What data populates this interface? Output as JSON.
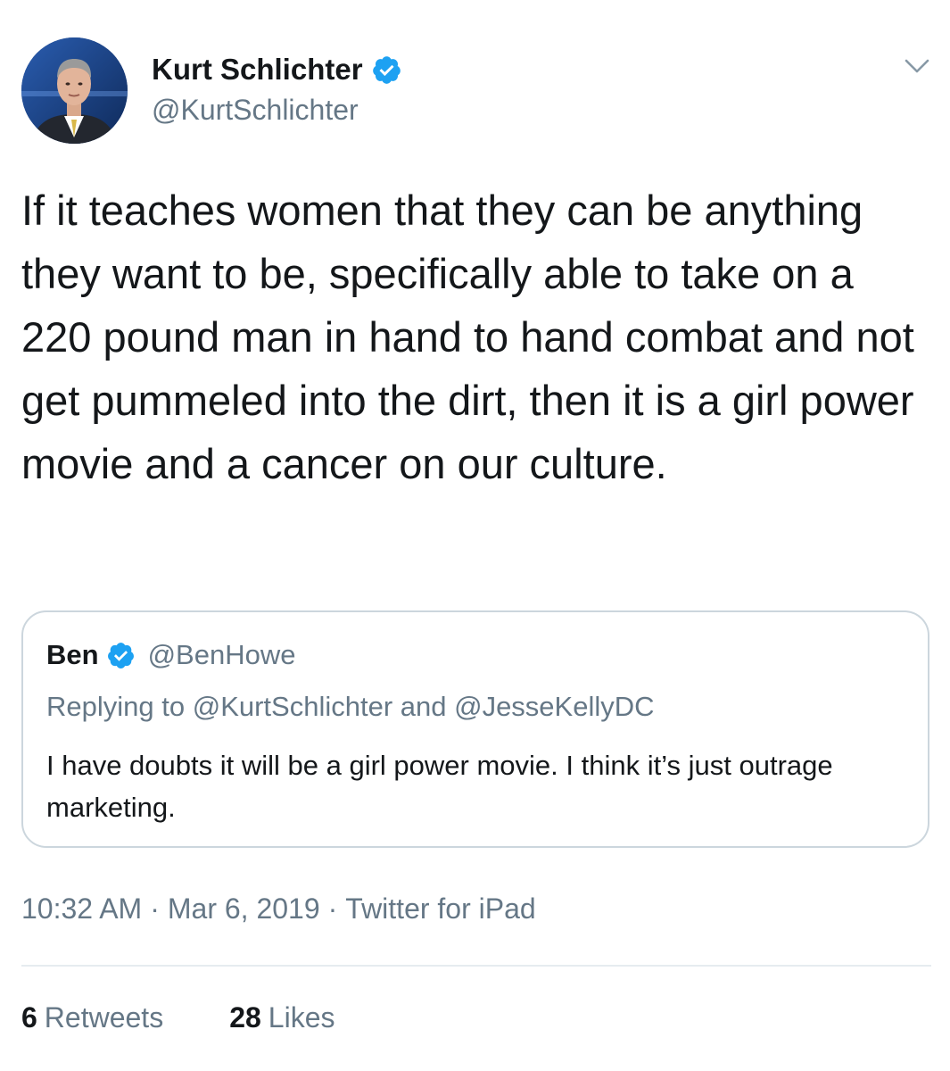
{
  "tweet": {
    "author": {
      "display_name": "Kurt Schlichter",
      "handle": "@KurtSchlichter",
      "verified": true
    },
    "text": "If it teaches women that they can be anything they want to be, specifically able to take on a 220 pound man in hand to hand combat and not get pummeled into the dirt, then it is a girl power movie and a cancer on our culture.",
    "quoted_tweet": {
      "display_name": "Ben",
      "handle": "@BenHowe",
      "verified": true,
      "replying_to_prefix": "Replying to",
      "replying_to_users": "@KurtSchlichter and @JesseKellyDC",
      "text": "I have doubts it will be a girl power movie. I think it’s just outrage marketing."
    },
    "meta": {
      "time": "10:32 AM",
      "date": "Mar 6, 2019",
      "separator": "·",
      "source": "Twitter for iPad"
    },
    "stats": {
      "retweets_count": "6",
      "retweets_label": "Retweets",
      "likes_count": "28",
      "likes_label": "Likes"
    }
  },
  "icons": {
    "verified": "verified-badge-icon",
    "menu": "chevron-down-icon"
  },
  "colors": {
    "text_primary": "#14171a",
    "text_secondary": "#657786",
    "verified_blue": "#1da1f2",
    "border": "#ccd6dd"
  }
}
